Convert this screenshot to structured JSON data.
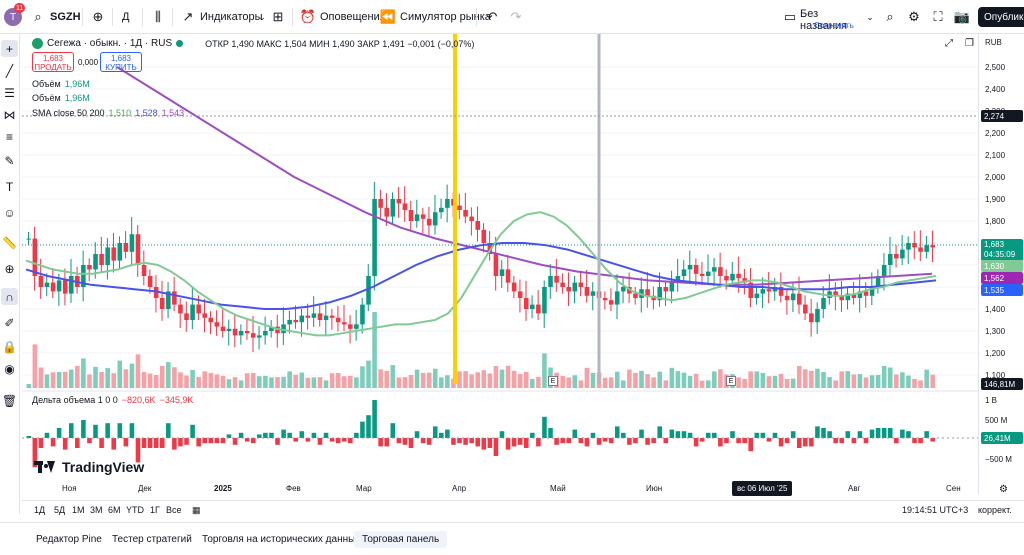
{
  "topbar": {
    "avatar_letter": "T",
    "notif_count": "11",
    "symbol": "SGZH",
    "interval": "Д",
    "indicators": "Индикаторы",
    "alerts": "Оповещения",
    "replay": "Симулятор рынка",
    "layout_name": "Без названия",
    "layout_status": "Сохранить",
    "publish": "Опубликовать"
  },
  "legend": {
    "symbol_name": "Сегежа · обыкн. · 1Д · RUS",
    "ohlc": "ОТКР 1,490 МАКС 1,504 МИН 1,490 ЗАКР 1,491 −0,001 (−0,07%)",
    "sell_price": "1,683",
    "sell_label": "ПРОДАТЬ",
    "spread": "0,000",
    "buy_price": "1,683",
    "buy_label": "КУПИТЬ",
    "volume1_label": "Объём",
    "volume1_value": "1,96M",
    "volume2_label": "Объём",
    "volume2_value": "1,96M",
    "sma_label": "SMA close 50 200",
    "sma_v1": "1,510",
    "sma_v2": "1,528",
    "sma_v3": "1,543",
    "delta_label": "Дельта объема 1 0 0",
    "delta_v1": "−820,6K",
    "delta_v2": "−345,9K"
  },
  "brand": "TradingView",
  "colors": {
    "up": "#089981",
    "down": "#f23645",
    "sma50": "#81c995",
    "sma200": "#4a52e8",
    "sma_long": "#9c4fbf",
    "yellow_line": "#f6d300",
    "gray_line": "#b2b5be"
  },
  "price_scale": {
    "currency": "RUB",
    "ticks": [
      "2,500",
      "2,400",
      "2,300",
      "2,200",
      "2,100",
      "2,000",
      "1,900",
      "1,800",
      "1,700",
      "1,600",
      "1,500",
      "1,400",
      "1,300",
      "1,200",
      "1,100"
    ],
    "crosshair_price": "2,274",
    "last_price": "1,683",
    "countdown": "04:35:09",
    "tag_sma50": "1,630",
    "tag_sma_long": "1,562",
    "tag_sma200": "1,535",
    "volume_tag": "146,81M",
    "delta_ticks": [
      "1 B",
      "500 M",
      "−500 M"
    ],
    "delta_tag": "26,41M"
  },
  "time_axis": {
    "labels": [
      "Ноя",
      "Дек",
      "2025",
      "Фев",
      "Мар",
      "Апр",
      "Май",
      "Июн",
      "Июл",
      "Авг",
      "Сен"
    ],
    "highlighted": "вс 06 Июл '25"
  },
  "range_bar": {
    "ranges": [
      "1Д",
      "5Д",
      "1М",
      "3М",
      "6М",
      "YTD",
      "1Г",
      "Все"
    ],
    "clock": "19:14:51 UTC+3",
    "adjust": "коррект."
  },
  "bottom_tabs": [
    "Редактор Pine",
    "Тестер стратегий",
    "Торговля на исторических данных",
    "Торговая панель"
  ],
  "event_marker": "E",
  "chart_data": {
    "type": "candlestick",
    "price_range": [
      1000,
      2550
    ],
    "price_series": [
      1.72,
      1.55,
      1.5,
      1.52,
      1.48,
      1.53,
      1.47,
      1.55,
      1.5,
      1.6,
      1.58,
      1.65,
      1.6,
      1.68,
      1.62,
      1.7,
      1.66,
      1.74,
      1.6,
      1.55,
      1.5,
      1.45,
      1.4,
      1.48,
      1.42,
      1.38,
      1.35,
      1.42,
      1.38,
      1.36,
      1.34,
      1.32,
      1.3,
      1.31,
      1.28,
      1.3,
      1.29,
      1.27,
      1.28,
      1.3,
      1.32,
      1.29,
      1.33,
      1.35,
      1.34,
      1.37,
      1.36,
      1.38,
      1.35,
      1.37,
      1.36,
      1.34,
      1.33,
      1.31,
      1.33,
      1.42,
      1.55,
      1.9,
      1.86,
      1.82,
      1.9,
      1.88,
      1.85,
      1.8,
      1.83,
      1.81,
      1.78,
      1.84,
      1.86,
      1.9,
      1.87,
      1.85,
      1.82,
      1.8,
      1.76,
      1.7,
      1.65,
      1.55,
      1.58,
      1.52,
      1.48,
      1.45,
      1.4,
      1.42,
      1.38,
      1.5,
      1.55,
      1.52,
      1.5,
      1.48,
      1.52,
      1.5,
      1.46,
      1.48,
      1.45,
      1.44,
      1.42,
      1.48,
      1.5,
      1.47,
      1.45,
      1.49,
      1.46,
      1.44,
      1.5,
      1.48,
      1.52,
      1.55,
      1.58,
      1.6,
      1.56,
      1.55,
      1.57,
      1.59,
      1.55,
      1.53,
      1.56,
      1.54,
      1.52,
      1.45,
      1.47,
      1.49,
      1.48,
      1.5,
      1.46,
      1.44,
      1.47,
      1.42,
      1.38,
      1.34,
      1.4,
      1.45,
      1.48,
      1.46,
      1.44,
      1.47,
      1.45,
      1.48,
      1.46,
      1.5,
      1.55,
      1.6,
      1.65,
      1.63,
      1.67,
      1.7,
      1.68,
      1.66,
      1.69,
      1.68
    ],
    "sma50": [
      1.62,
      1.6,
      1.58,
      1.57,
      1.56,
      1.56,
      1.57,
      1.58,
      1.6,
      1.61,
      1.6,
      1.57,
      1.53,
      1.48,
      1.44,
      1.4,
      1.37,
      1.35,
      1.33,
      1.31,
      1.3,
      1.29,
      1.28,
      1.28,
      1.29,
      1.3,
      1.31,
      1.32,
      1.33,
      1.33,
      1.34,
      1.35,
      1.38,
      1.45,
      1.55,
      1.65,
      1.74,
      1.8,
      1.83,
      1.84,
      1.82,
      1.78,
      1.72,
      1.65,
      1.58,
      1.52,
      1.48,
      1.46,
      1.45,
      1.44,
      1.45,
      1.47,
      1.49,
      1.51,
      1.52,
      1.53,
      1.53,
      1.52,
      1.5,
      1.48,
      1.47,
      1.46,
      1.46,
      1.47,
      1.49,
      1.5,
      1.52,
      1.53,
      1.54,
      1.55
    ],
    "sma200": [
      1.58,
      1.55,
      1.53,
      1.51,
      1.5,
      1.49,
      1.48,
      1.46,
      1.44,
      1.42,
      1.41,
      1.4,
      1.4,
      1.41,
      1.43,
      1.46,
      1.5,
      1.55,
      1.6,
      1.64,
      1.67,
      1.69,
      1.7,
      1.7,
      1.69,
      1.67,
      1.64,
      1.61,
      1.58,
      1.55,
      1.53,
      1.52,
      1.51,
      1.5,
      1.5,
      1.49,
      1.49,
      1.49,
      1.5,
      1.5,
      1.51,
      1.52,
      1.53
    ],
    "sma_long": [
      2.5,
      2.4,
      2.3,
      2.2,
      2.1,
      2.0,
      1.92,
      1.84,
      1.77,
      1.72,
      1.68,
      1.64,
      1.6,
      1.57,
      1.55,
      1.53,
      1.52,
      1.51,
      1.51,
      1.52,
      1.53,
      1.54,
      1.55,
      1.56
    ]
  }
}
